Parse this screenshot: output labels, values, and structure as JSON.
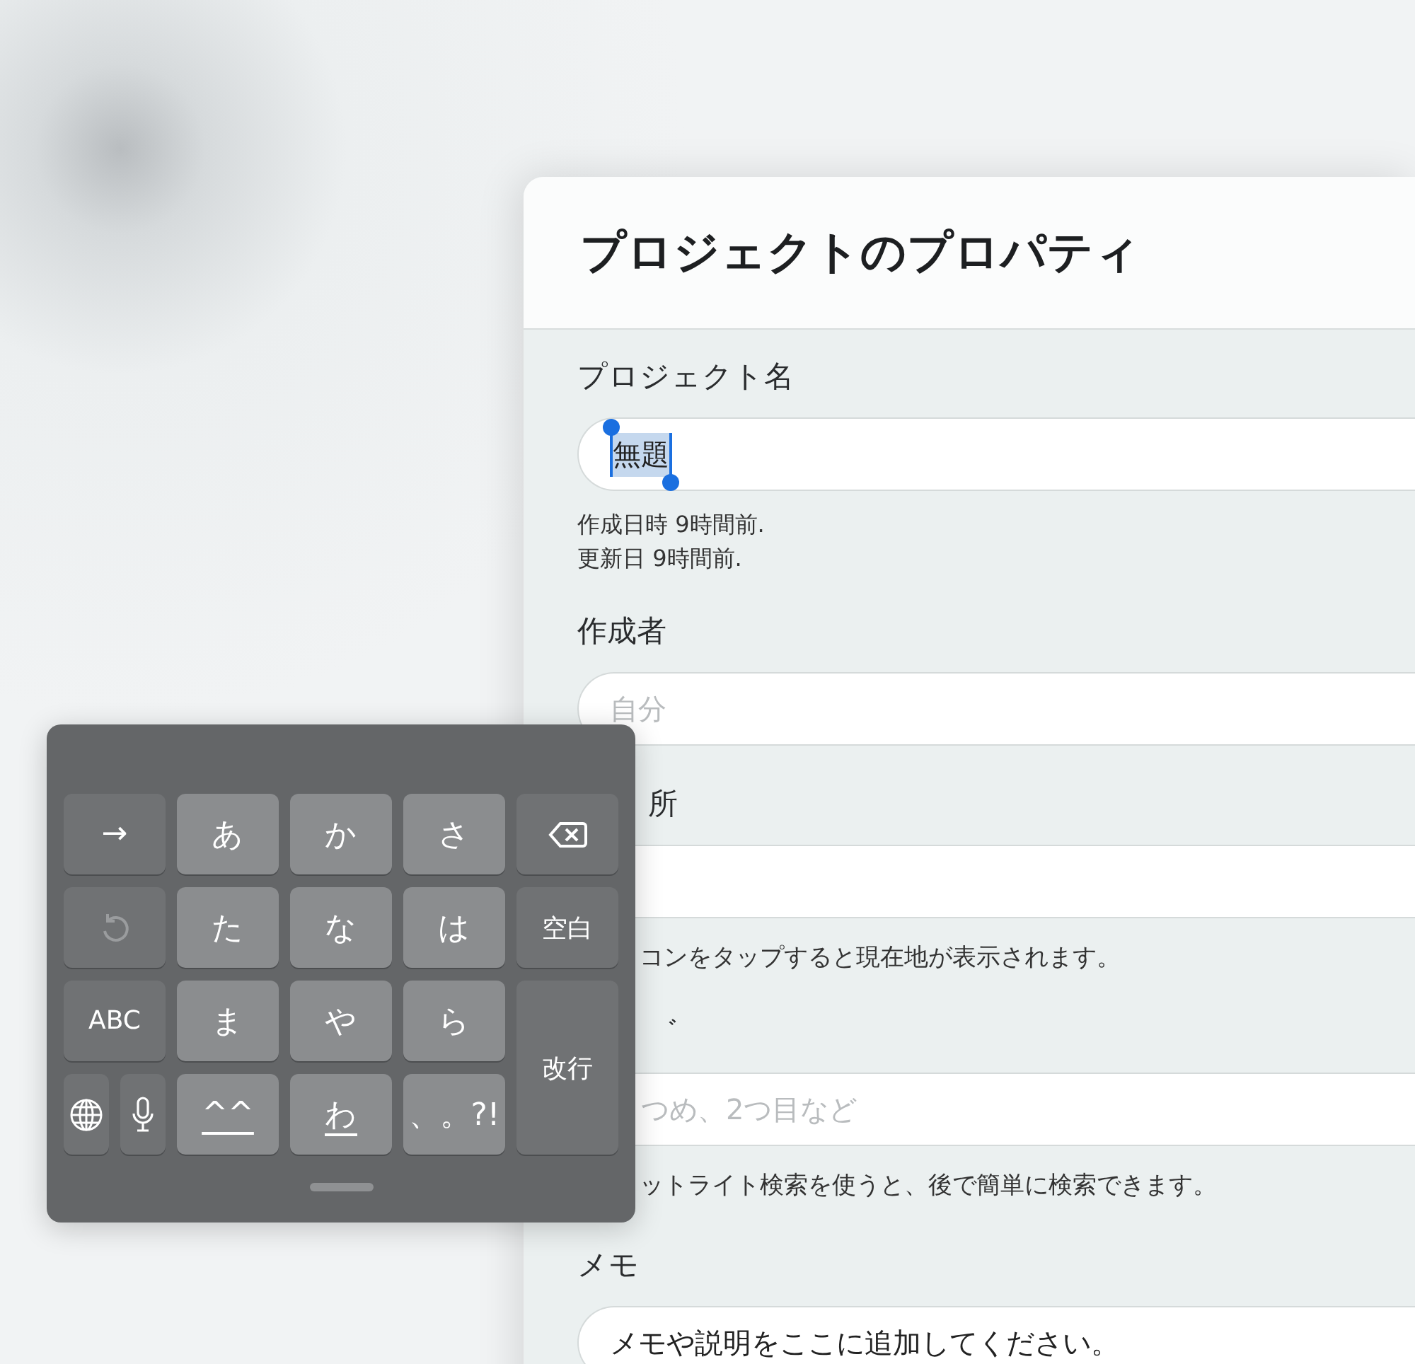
{
  "dialog": {
    "title": "プロジェクトのプロパティ"
  },
  "name_field": {
    "label": "プロジェクト名",
    "value": "無題",
    "text_selected": true
  },
  "meta": [
    "作成日時 9時間前.",
    "更新日 9時間前."
  ],
  "author_field": {
    "label": "作成者",
    "placeholder": "自分"
  },
  "location_field": {
    "label": "所",
    "hint": "コンをタップすると現在地が表示されます。"
  },
  "tags_field": {
    "label": "゛",
    "placeholder": "つめ、2つ目など",
    "hint": "ットライト検索を使うと、後で簡単に検索できます。"
  },
  "memo_field": {
    "label": "メモ",
    "value": "メモや説明をここに追加してください。"
  },
  "keyboard": {
    "keys": [
      {
        "kind": "function",
        "label": "→"
      },
      {
        "kind": "char",
        "label": "あ"
      },
      {
        "kind": "char",
        "label": "か"
      },
      {
        "kind": "char",
        "label": "さ"
      },
      {
        "kind": "delete"
      },
      {
        "kind": "undo"
      },
      {
        "kind": "char",
        "label": "た"
      },
      {
        "kind": "char",
        "label": "な"
      },
      {
        "kind": "char",
        "label": "は"
      },
      {
        "kind": "action",
        "label": "空白"
      },
      {
        "kind": "function",
        "label": "ABC"
      },
      {
        "kind": "char",
        "label": "ま"
      },
      {
        "kind": "char",
        "label": "や"
      },
      {
        "kind": "char",
        "label": "ら"
      },
      {
        "kind": "return",
        "label": "改行"
      },
      {
        "kind": "globe"
      },
      {
        "kind": "mic"
      },
      {
        "kind": "char",
        "label": "^^",
        "underline": true
      },
      {
        "kind": "char",
        "label": "わ",
        "underline": true
      },
      {
        "kind": "char",
        "label": "、。?!"
      }
    ]
  }
}
